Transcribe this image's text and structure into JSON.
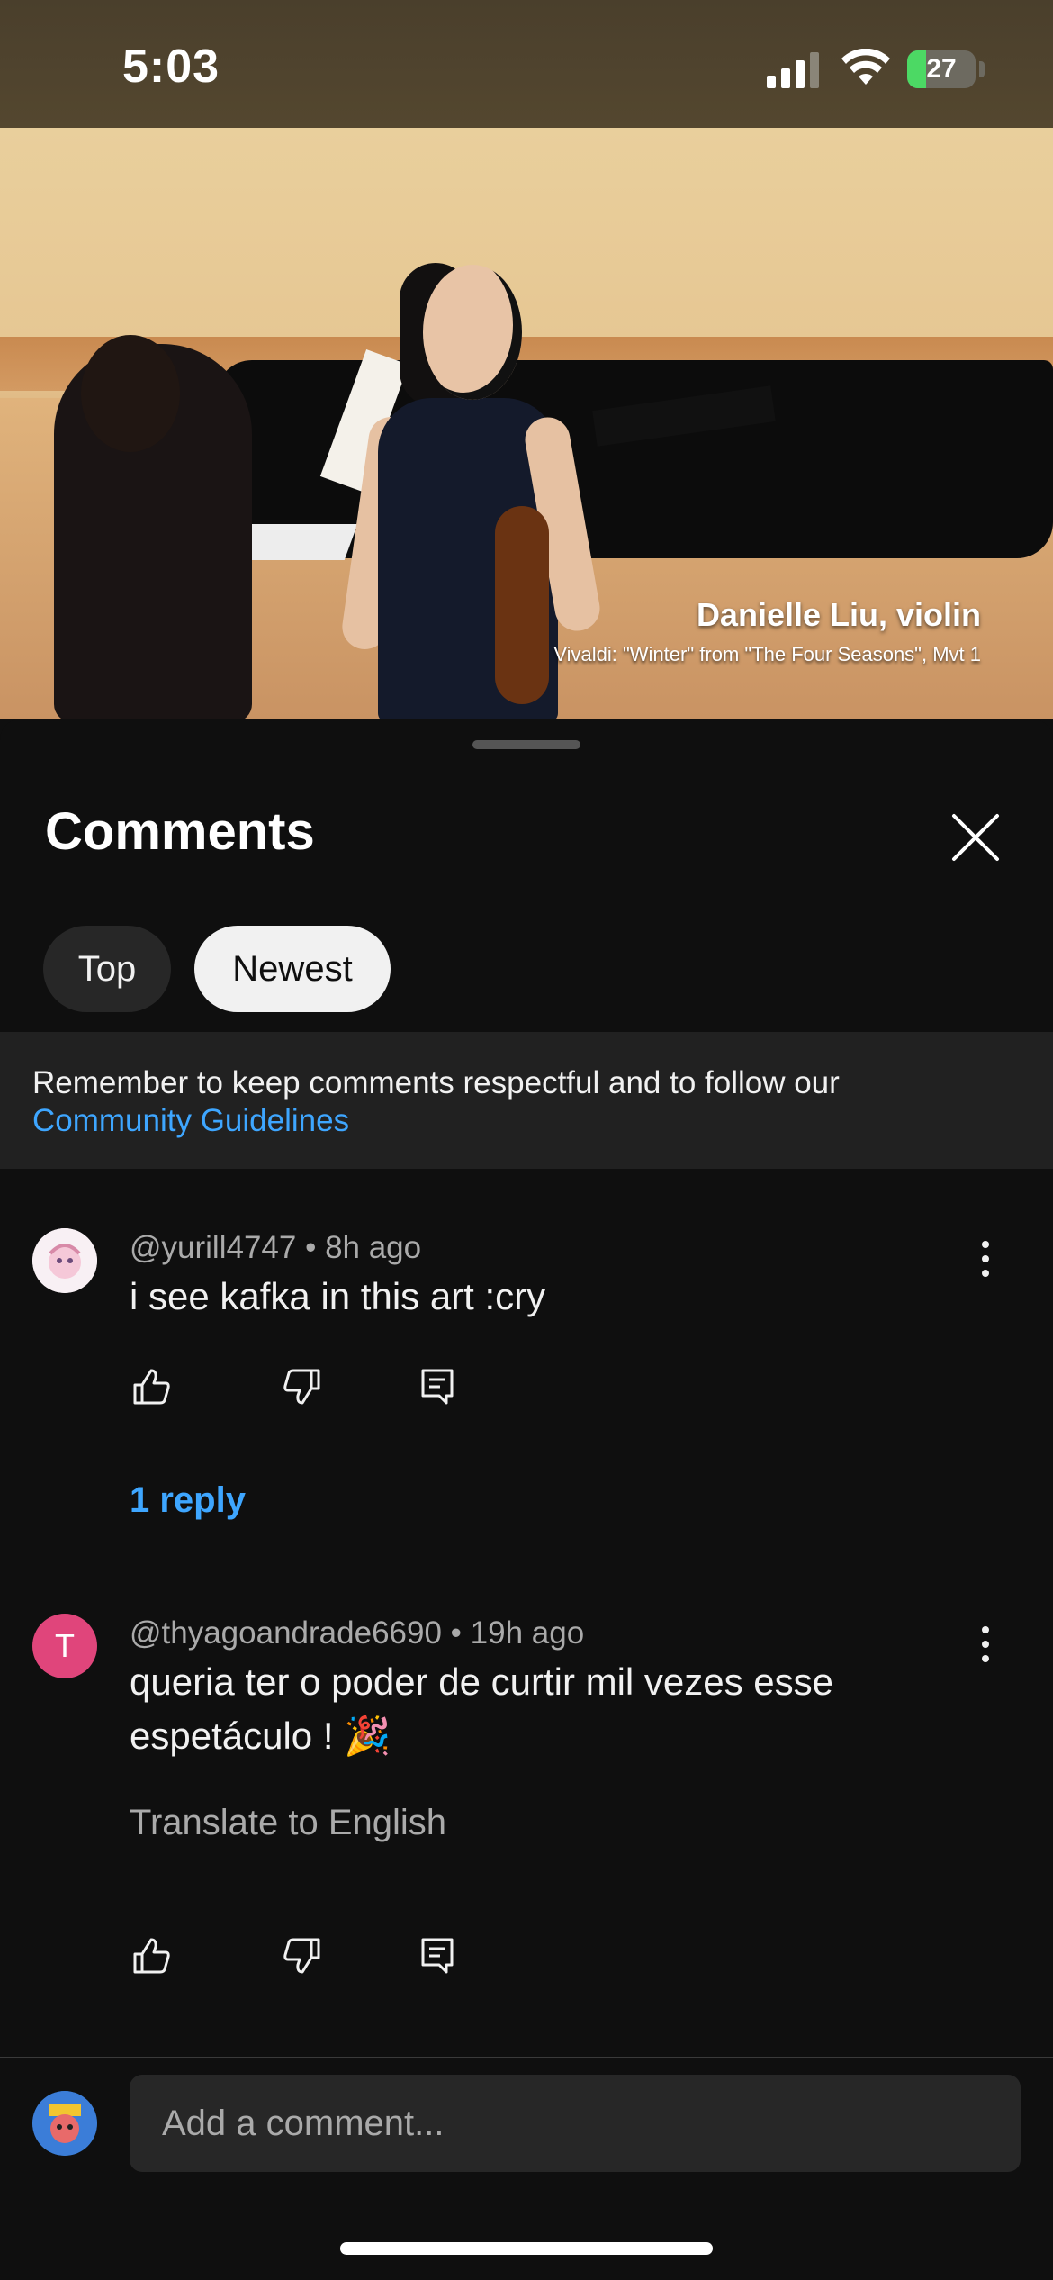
{
  "status_bar": {
    "time": "5:03",
    "battery_level": "27",
    "battery_percent": 27,
    "icons": [
      "signal-icon",
      "wifi-icon",
      "battery-charging-icon"
    ]
  },
  "video": {
    "caption_name": "Danielle Liu, violin",
    "caption_subtitle": "Vivaldi: \"Winter\" from \"The Four Seasons\", Mvt 1",
    "progress_fraction": 0.025
  },
  "comments_panel": {
    "title": "Comments",
    "sort_tabs": [
      {
        "label": "Top",
        "selected": false
      },
      {
        "label": "Newest",
        "selected": true
      }
    ],
    "notice": {
      "text": "Remember to keep comments respectful and to follow our",
      "link": "Community Guidelines"
    },
    "comments": [
      {
        "handle": "@yurill4747",
        "time": "8h ago",
        "text": "i see kafka in this art :cry",
        "replies_label": "1 reply"
      },
      {
        "handle": "@thyagoandrade6690",
        "time": "19h ago",
        "avatar_letter": "T",
        "text_line1": "queria ter o poder de curtir mil vezes esse",
        "text_line2": "espetáculo ! 🎉",
        "translate_label": "Translate to English"
      }
    ]
  },
  "comment_input": {
    "placeholder": "Add a comment..."
  },
  "colors": {
    "accent_link": "#3ea6ff",
    "background": "#0f0f0f",
    "avatar_t": "#e0457b"
  }
}
